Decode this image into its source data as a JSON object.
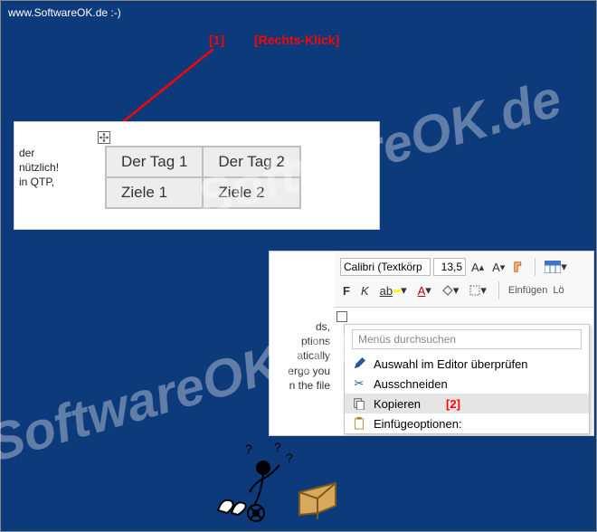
{
  "header": {
    "url": "www.SoftwareOK.de :-)"
  },
  "annot": {
    "a1": "[1]",
    "a1_label": "[Rechts-Klick]",
    "a2": "[2]"
  },
  "panel1": {
    "text": [
      "der",
      "nützlich!",
      "in QTP,"
    ],
    "table": [
      [
        "Der Tag 1",
        "Der Tag 2"
      ],
      [
        "Ziele 1",
        "Ziele 2"
      ]
    ]
  },
  "panel2": {
    "text": [
      "ds,",
      "ptions",
      "atically",
      "ergo you",
      "n the file"
    ],
    "toolbar": {
      "font": "Calibri (Textkörp",
      "size": "13,5",
      "einfuegen": "Einfügen",
      "lo": "Lö"
    },
    "menu": {
      "search_placeholder": "Menüs durchsuchen",
      "items": [
        {
          "label": "Auswahl im Editor überprüfen",
          "icon": "pen"
        },
        {
          "label": "Ausschneiden",
          "icon": "scissors"
        },
        {
          "label": "Kopieren",
          "icon": "copy",
          "highlight": true
        },
        {
          "label": "Einfügeoptionen:",
          "icon": "clipboard"
        }
      ]
    }
  },
  "watermark": "SoftwareOK.de"
}
